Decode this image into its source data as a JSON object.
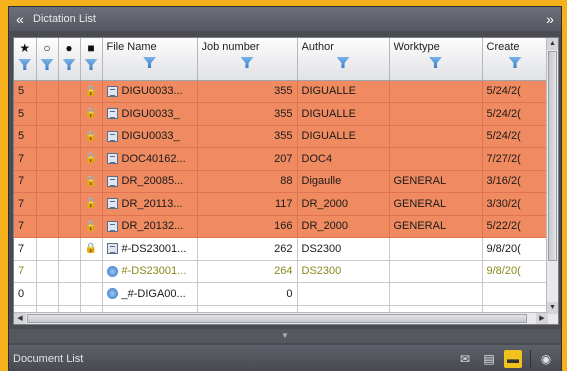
{
  "window": {
    "title": "Dictation List",
    "collapse_icon": "«",
    "expand_icon": "»"
  },
  "columns": [
    {
      "key": "priority",
      "icon": "★",
      "icon_name": "star-icon"
    },
    {
      "key": "comment",
      "icon": "○",
      "icon_name": "comment-icon"
    },
    {
      "key": "flag",
      "icon": "●",
      "icon_name": "pin-icon"
    },
    {
      "key": "lock",
      "icon": "■",
      "icon_name": "lock-icon"
    },
    {
      "key": "file_name",
      "label": "File Name"
    },
    {
      "key": "job_number",
      "label": "Job number"
    },
    {
      "key": "author",
      "label": "Author"
    },
    {
      "key": "worktype",
      "label": "Worktype"
    },
    {
      "key": "created",
      "label": "Create"
    }
  ],
  "rows": [
    {
      "style": "orange",
      "priority": "5",
      "lock": "🔒",
      "icon": "file-icon",
      "file_name": "DIGU0033...",
      "job_number": "355",
      "author": "DIGUALLE",
      "worktype": "",
      "created": "5/24/2("
    },
    {
      "style": "orange",
      "priority": "5",
      "lock": "🔒",
      "icon": "file-icon",
      "file_name": "DIGU0033_",
      "job_number": "355",
      "author": "DIGUALLE",
      "worktype": "",
      "created": "5/24/2("
    },
    {
      "style": "orange",
      "priority": "5",
      "lock": "🔒",
      "icon": "file-icon",
      "file_name": "DIGU0033_",
      "job_number": "355",
      "author": "DIGUALLE",
      "worktype": "",
      "created": "5/24/2("
    },
    {
      "style": "orange",
      "priority": "7",
      "lock": "🔒",
      "icon": "file-icon",
      "file_name": "DOC40162...",
      "job_number": "207",
      "author": "DOC4",
      "worktype": "",
      "created": "7/27/2("
    },
    {
      "style": "orange",
      "priority": "7",
      "lock": "🔒",
      "icon": "file-icon",
      "file_name": "DR_20085...",
      "job_number": "88",
      "author": "Digaulle",
      "worktype": "GENERAL",
      "created": "3/16/2("
    },
    {
      "style": "orange",
      "priority": "7",
      "lock": "🔒",
      "icon": "file-icon",
      "file_name": "DR_20113...",
      "job_number": "117",
      "author": "DR_2000",
      "worktype": "GENERAL",
      "created": "3/30/2("
    },
    {
      "style": "orange",
      "priority": "7",
      "lock": "🔒",
      "icon": "file-icon",
      "file_name": "DR_20132...",
      "job_number": "166",
      "author": "DR_2000",
      "worktype": "GENERAL",
      "created": "5/22/2("
    },
    {
      "style": "white",
      "priority": "7",
      "lock": "🔒",
      "icon": "file-icon",
      "file_name": "#-DS23001...",
      "job_number": "262",
      "author": "DS2300",
      "worktype": "",
      "created": "9/8/20("
    },
    {
      "style": "white olive",
      "priority": "7",
      "lock": "",
      "icon": "voice-icon",
      "file_name": "#-DS23001...",
      "job_number": "264",
      "author": "DS2300",
      "worktype": "",
      "created": "9/8/20("
    },
    {
      "style": "white",
      "priority": "0",
      "lock": "",
      "icon": "voice-icon",
      "file_name": "_#-DIGA00...",
      "job_number": "0",
      "author": "",
      "worktype": "",
      "created": ""
    },
    {
      "style": "white",
      "priority": "",
      "lock": "",
      "icon": "",
      "file_name": "",
      "job_number": "",
      "author": "",
      "worktype": "",
      "created": ""
    }
  ],
  "bottom": {
    "label": "Document List",
    "icons": [
      "mail-icon",
      "document-icon",
      "folder-icon",
      "globe-icon"
    ]
  },
  "colors": {
    "background": "#f5b11c",
    "row_highlight": "#f08a60",
    "frame": "#4a4c52"
  }
}
